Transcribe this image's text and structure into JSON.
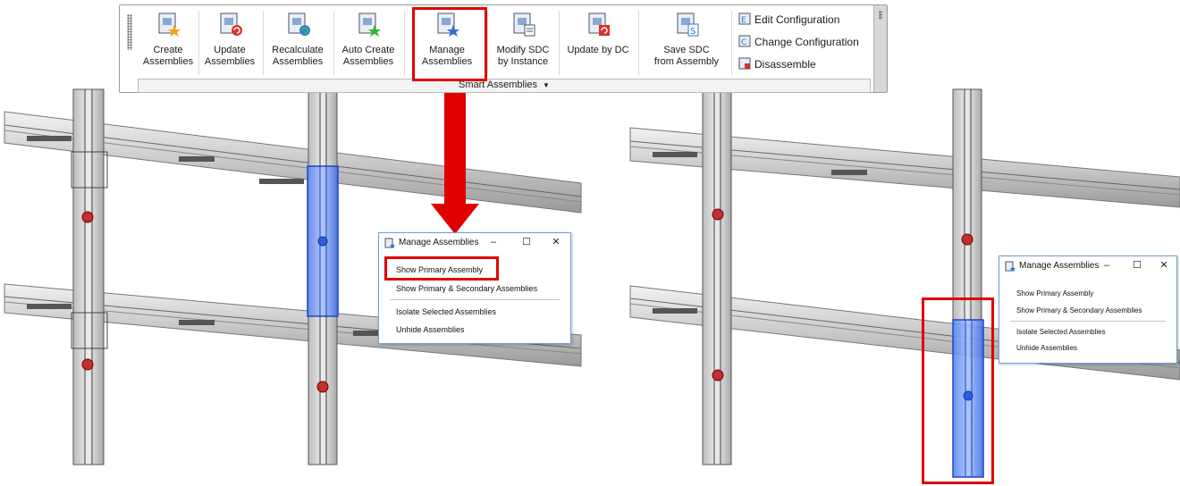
{
  "ribbon": {
    "panel_title": "Smart Assemblies",
    "buttons": [
      {
        "line1": "Create",
        "line2": "Assemblies"
      },
      {
        "line1": "Update",
        "line2": "Assemblies"
      },
      {
        "line1": "Recalculate",
        "line2": "Assemblies"
      },
      {
        "line1": "Auto Create",
        "line2": "Assemblies"
      },
      {
        "line1": "Manage",
        "line2": "Assemblies"
      },
      {
        "line1": "Modify SDC",
        "line2": "by Instance"
      },
      {
        "line1": "Update by DC",
        "line2": ""
      },
      {
        "line1": "Save SDC",
        "line2": "from Assembly"
      }
    ],
    "small_items": [
      "Edit Configuration",
      "Change Configuration",
      "Disassemble"
    ]
  },
  "dialog_left": {
    "title": "Manage Assemblies",
    "items": [
      "Show Primary Assembly",
      "Show Primary & Secondary Assemblies",
      "Isolate Selected Assemblies",
      "Unhide Assemblies"
    ]
  },
  "dialog_right": {
    "title": "Manage Assemblies",
    "items": [
      "Show Primary Assembly",
      "Show Primary & Secondary Assemblies",
      "Isolate Selected Assemblies",
      "Unhide Assemblies"
    ]
  },
  "window_controls": {
    "minimize": "–",
    "maximize": "☐",
    "close": "✕"
  },
  "colors": {
    "highlight": "#e00000",
    "assembly_blue": "#2b5fe0",
    "steel_gray": "#8c8c8c",
    "connection_red": "#c03030"
  }
}
